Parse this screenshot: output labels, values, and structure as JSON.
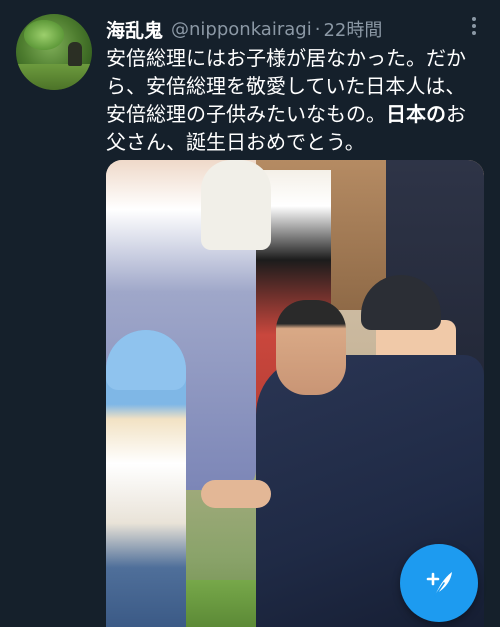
{
  "tweet": {
    "display_name": "海乱鬼",
    "handle": "@nipponkairagi",
    "separator": "·",
    "time": "22時間",
    "text_lines": [
      {
        "plain": "安倍総理にはお子様が居なかった。だか",
        "bold": "",
        "after": ""
      },
      {
        "plain": "ら、安倍総理を敬愛していた日本人は、",
        "bold": "",
        "after": ""
      },
      {
        "plain": "安倍総理の子供みたいなもの。",
        "bold": "日本の",
        "after": "お"
      },
      {
        "plain": "父さん、誕生日おめでとう。",
        "bold": "",
        "after": ""
      }
    ]
  },
  "icons": {
    "more": "more-vertical-icon",
    "compose": "compose-feather-plus-icon"
  },
  "colors": {
    "background": "#15202b",
    "secondary_text": "#8b98a5",
    "accent": "#1d9bf0"
  }
}
